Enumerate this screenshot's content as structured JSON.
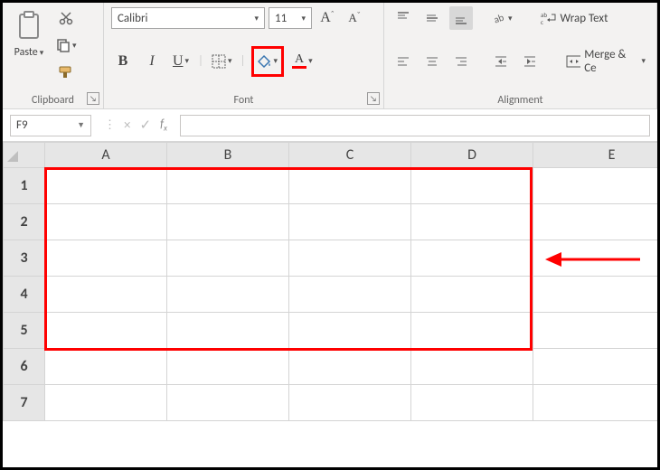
{
  "ribbon": {
    "clipboard": {
      "label": "Clipboard",
      "paste": "Paste"
    },
    "font": {
      "label": "Font",
      "name": "Calibri",
      "size": "11",
      "bold": "B",
      "italic": "I",
      "underline": "U"
    },
    "alignment": {
      "label": "Alignment",
      "wrap": "Wrap Text",
      "merge": "Merge & Ce"
    }
  },
  "namebox": {
    "value": "F9"
  },
  "grid": {
    "columns": [
      "A",
      "B",
      "C",
      "D",
      "E"
    ],
    "rows": [
      "1",
      "2",
      "3",
      "4",
      "5",
      "6",
      "7"
    ]
  }
}
